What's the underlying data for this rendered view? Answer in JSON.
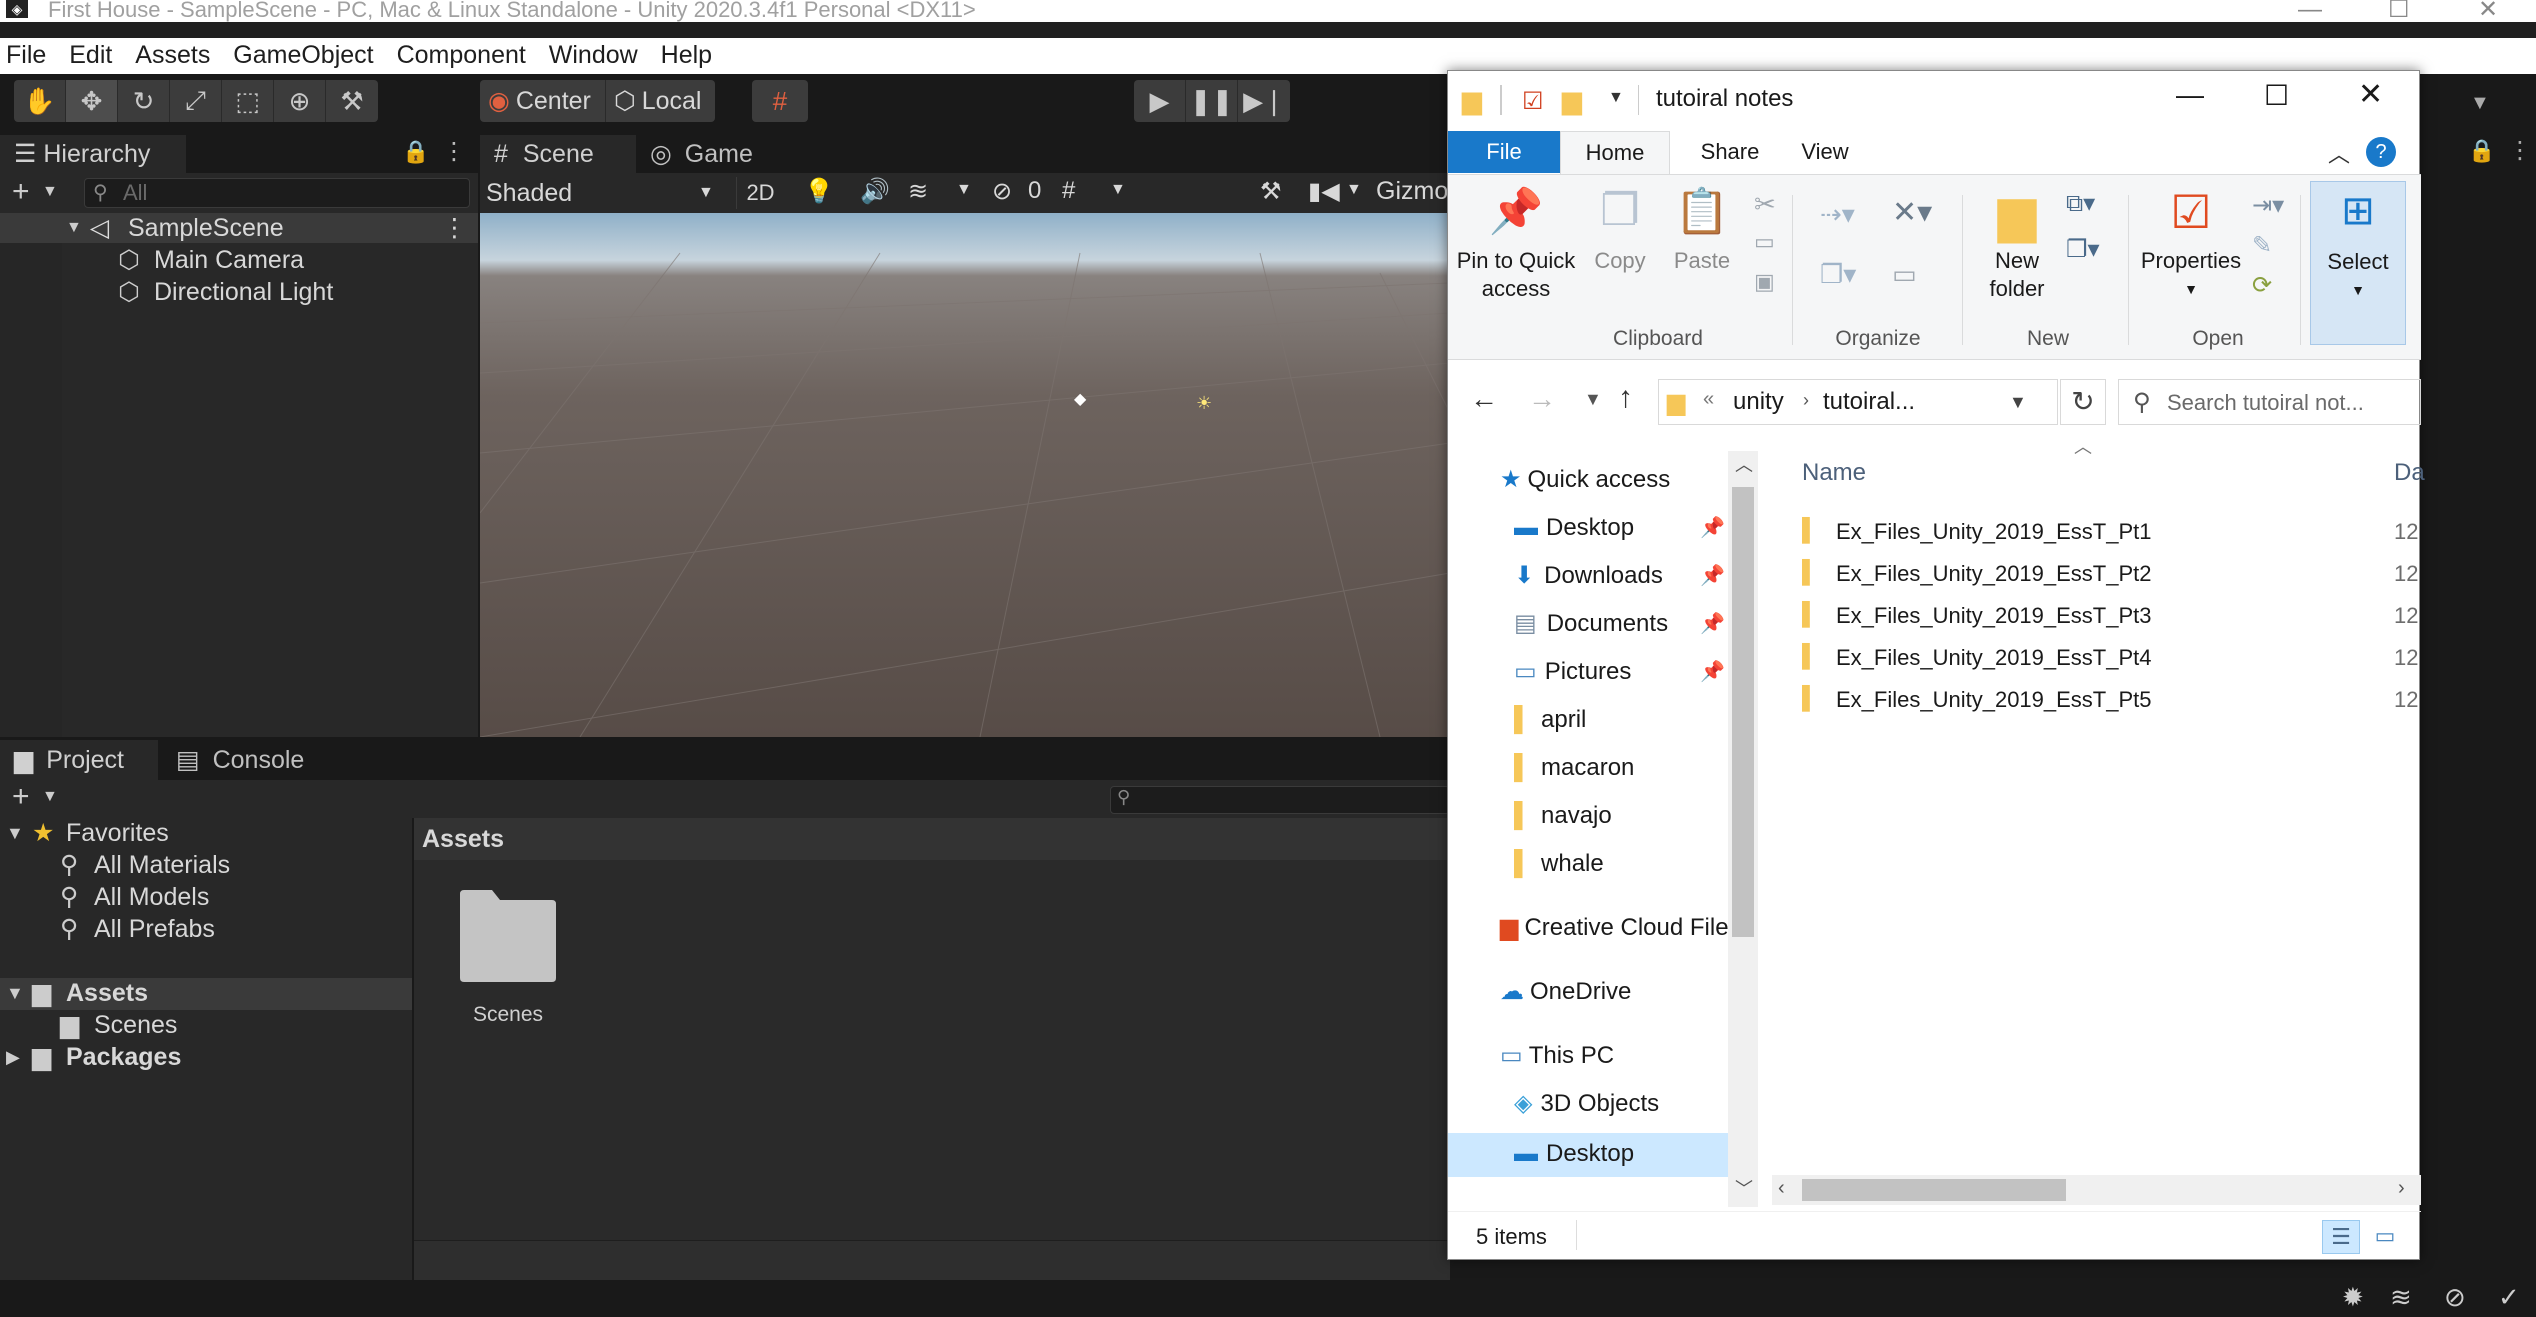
{
  "unity": {
    "title": "First House - SampleScene - PC, Mac & Linux Standalone - Unity 2020.3.4f1 Personal <DX11>",
    "menu": [
      "File",
      "Edit",
      "Assets",
      "GameObject",
      "Component",
      "Window",
      "Help"
    ],
    "toolbar": {
      "pivot_label": "Center",
      "space_label": "Local"
    },
    "hierarchy": {
      "tab": "Hierarchy",
      "search_placeholder": "All",
      "scene": "SampleScene",
      "items": [
        "Main Camera",
        "Directional Light"
      ]
    },
    "scene_view": {
      "tabs": [
        "Scene",
        "Game"
      ],
      "shading_mode": "Shaded",
      "mode_2d": "2D",
      "hidden_count": "0",
      "gizmos_label": "Gizmo"
    },
    "project": {
      "tabs": [
        "Project",
        "Console"
      ],
      "favorites": {
        "label": "Favorites",
        "items": [
          "All Materials",
          "All Models",
          "All Prefabs"
        ]
      },
      "tree": {
        "assets": "Assets",
        "scenes": "Scenes",
        "packages": "Packages"
      },
      "breadcrumb": "Assets",
      "asset_items": [
        "Scenes"
      ]
    }
  },
  "explorer": {
    "title": "tutoiral notes",
    "ribbon_tabs": [
      "File",
      "Home",
      "Share",
      "View"
    ],
    "ribbon": {
      "pin": "Pin to Quick access",
      "copy": "Copy",
      "paste": "Paste",
      "new_folder": "New folder",
      "properties": "Properties",
      "select": "Select",
      "groups": [
        "Clipboard",
        "Organize",
        "New",
        "Open"
      ]
    },
    "address": {
      "overflow": "«",
      "parts": [
        "unity",
        "tutoiral..."
      ]
    },
    "search_placeholder": "Search tutoiral not...",
    "nav": {
      "quick_access": "Quick access",
      "pinned": [
        "Desktop",
        "Downloads",
        "Documents",
        "Pictures"
      ],
      "folders": [
        "april",
        "macaron",
        "navajo",
        "whale"
      ],
      "creative_cloud": "Creative Cloud File",
      "onedrive": "OneDrive",
      "this_pc": "This PC",
      "pc_items": [
        "3D Objects",
        "Desktop"
      ]
    },
    "columns": {
      "name": "Name",
      "date": "Da"
    },
    "files": [
      {
        "name": "Ex_Files_Unity_2019_EssT_Pt1",
        "date": "12"
      },
      {
        "name": "Ex_Files_Unity_2019_EssT_Pt2",
        "date": "12"
      },
      {
        "name": "Ex_Files_Unity_2019_EssT_Pt3",
        "date": "12"
      },
      {
        "name": "Ex_Files_Unity_2019_EssT_Pt4",
        "date": "12"
      },
      {
        "name": "Ex_Files_Unity_2019_EssT_Pt5",
        "date": "12"
      }
    ],
    "status": "5 items",
    "colors": {
      "accent": "#1979ca",
      "folder": "#f6c758",
      "selection": "#cce8ff"
    }
  }
}
